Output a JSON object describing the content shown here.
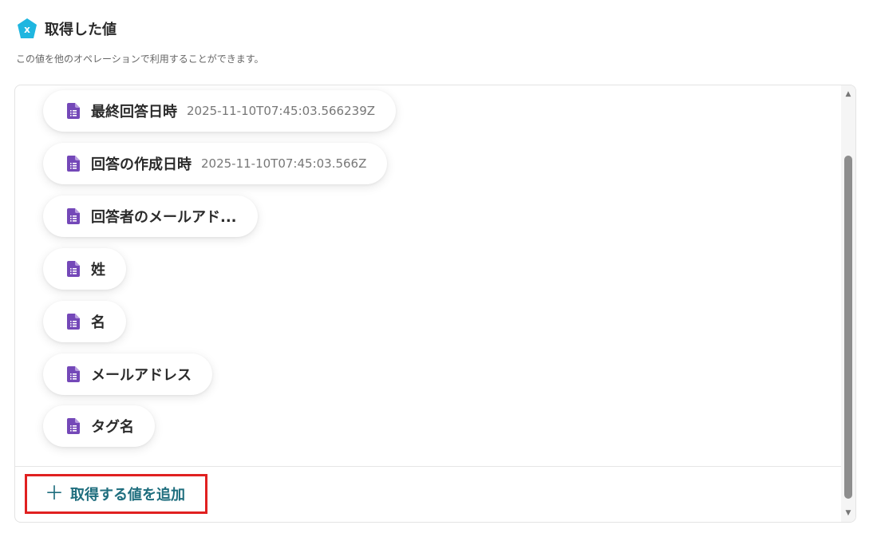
{
  "header": {
    "title": "取得した値",
    "description": "この値を他のオペレーションで利用することができます。",
    "logo_color": "#1fb6e0"
  },
  "values": [
    {
      "label": "最終回答日時",
      "value": "2025-11-10T07:45:03.566239Z",
      "icon": "google-forms-document-icon"
    },
    {
      "label": "回答の作成日時",
      "value": "2025-11-10T07:45:03.566Z",
      "icon": "google-forms-document-icon"
    },
    {
      "label": "回答者のメールアド...",
      "value": "",
      "icon": "google-forms-document-icon"
    },
    {
      "label": "姓",
      "value": "",
      "icon": "google-forms-document-icon"
    },
    {
      "label": "名",
      "value": "",
      "icon": "google-forms-document-icon"
    },
    {
      "label": "メールアドレス",
      "value": "",
      "icon": "google-forms-document-icon"
    },
    {
      "label": "タグ名",
      "value": "",
      "icon": "google-forms-document-icon"
    }
  ],
  "add_button": {
    "label": "取得する値を追加",
    "icon": "plus-icon",
    "highlight_color": "#e02020"
  },
  "colors": {
    "accent": "#1f6e7e",
    "forms_purple": "#7448b8"
  }
}
